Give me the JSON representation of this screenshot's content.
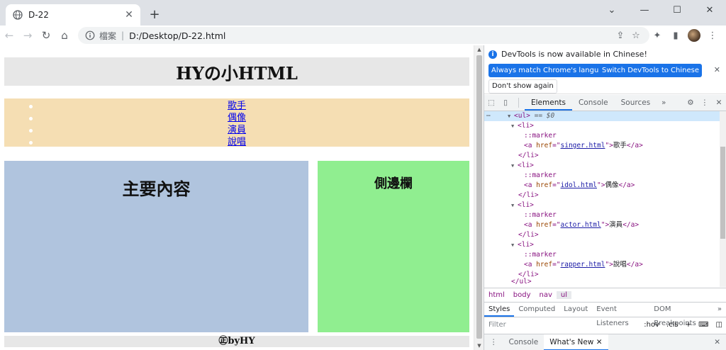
{
  "browser": {
    "tab": {
      "title": "D-22",
      "favicon": "globe-icon"
    },
    "omnibox": {
      "scheme": "檔案",
      "separator": "|",
      "url": "D:/Desktop/D-22.html"
    }
  },
  "page": {
    "header": "HYの小HTML",
    "nav": [
      "歌手",
      "偶像",
      "演員",
      "說唱"
    ],
    "main": "主要內容",
    "sidebar": "側邊欄",
    "footer": "㊣byHY"
  },
  "devtools": {
    "banner": {
      "message": "DevTools is now available in Chinese!",
      "btn_match": "Always match Chrome's language",
      "btn_switch": "Switch DevTools to Chinese",
      "btn_dont": "Don't show again"
    },
    "tabs": [
      "Elements",
      "Console",
      "Sources"
    ],
    "dom": {
      "ul_open": "<ul>",
      "selected_suffix": "== $0",
      "li_open": "<li>",
      "li_close": "</li>",
      "marker": "::marker",
      "ul_close": "</ul>",
      "items": [
        {
          "href": "singer.html",
          "text": "歌手"
        },
        {
          "href": "idol.html",
          "text": "偶像"
        },
        {
          "href": "actor.html",
          "text": "演員"
        },
        {
          "href": "rapper.html",
          "text": "說唱"
        }
      ]
    },
    "breadcrumbs": [
      "html",
      "body",
      "nav",
      "ul"
    ],
    "subtabs": [
      "Styles",
      "Computed",
      "Layout",
      "Event Listeners",
      "DOM Breakpoints"
    ],
    "filter": {
      "placeholder": "Filter",
      "hov": ":hov",
      "cls": ".cls"
    },
    "drawer": [
      "Console",
      "What's New"
    ]
  },
  "colors": {
    "header_bg": "#e7e7e7",
    "nav_bg": "#f5deb3",
    "main_bg": "#b0c4de",
    "sidebar_bg": "#90ee90",
    "accent": "#1a73e8"
  }
}
